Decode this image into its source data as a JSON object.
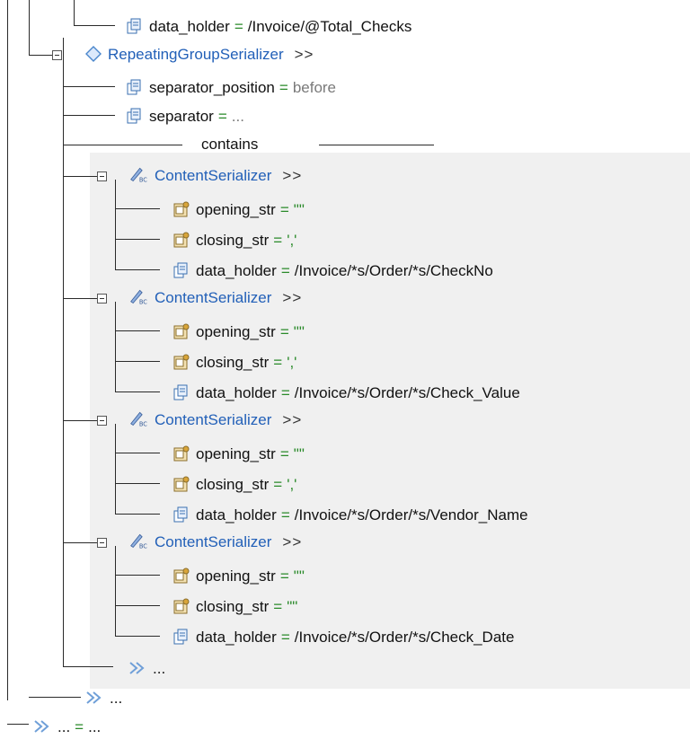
{
  "tree": {
    "total_checks_node": {
      "label": "data_holder",
      "operator": "=",
      "value": "/Invoice/@Total_Checks"
    },
    "repeating_group": {
      "label": "RepeatingGroupSerializer",
      "more": ">>"
    },
    "separator_position": {
      "label": "separator_position",
      "operator": "=",
      "value": "before"
    },
    "separator": {
      "label": "separator",
      "operator": "=",
      "value": "..."
    },
    "contains_label": "contains",
    "content_serializers": [
      {
        "label": "ContentSerializer",
        "more": ">>",
        "opening": {
          "label": "opening_str",
          "operator": "=",
          "value": "\"\""
        },
        "closing": {
          "label": "closing_str",
          "operator": "=",
          "value": "','"
        },
        "holder": {
          "label": "data_holder",
          "operator": "=",
          "value": "/Invoice/*s/Order/*s/CheckNo"
        }
      },
      {
        "label": "ContentSerializer",
        "more": ">>",
        "opening": {
          "label": "opening_str",
          "operator": "=",
          "value": "\"\""
        },
        "closing": {
          "label": "closing_str",
          "operator": "=",
          "value": "','"
        },
        "holder": {
          "label": "data_holder",
          "operator": "=",
          "value": "/Invoice/*s/Order/*s/Check_Value"
        }
      },
      {
        "label": "ContentSerializer",
        "more": ">>",
        "opening": {
          "label": "opening_str",
          "operator": "=",
          "value": "\"\""
        },
        "closing": {
          "label": "closing_str",
          "operator": "=",
          "value": "','"
        },
        "holder": {
          "label": "data_holder",
          "operator": "=",
          "value": "/Invoice/*s/Order/*s/Vendor_Name"
        }
      },
      {
        "label": "ContentSerializer",
        "more": ">>",
        "opening": {
          "label": "opening_str",
          "operator": "=",
          "value": "\"\""
        },
        "closing": {
          "label": "closing_str",
          "operator": "=",
          "value": "\"\""
        },
        "holder": {
          "label": "data_holder",
          "operator": "=",
          "value": "/Invoice/*s/Order/*s/Check_Date"
        }
      }
    ],
    "more_inner": "...",
    "more_outer": "...",
    "bottom": {
      "label": "...",
      "operator": "=",
      "value": "..."
    }
  },
  "colors": {
    "name": "#2260b8",
    "operator": "#2a8a2a",
    "panel": "#f0f0f0"
  },
  "icons": [
    "property-icon",
    "config-property-icon",
    "serializer-diamond-icon",
    "content-serializer-icon",
    "more-chevron-icon"
  ]
}
